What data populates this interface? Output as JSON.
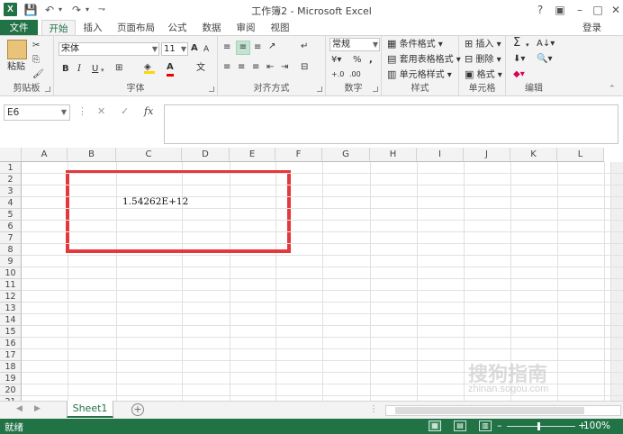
{
  "window": {
    "title": "工作簿2 - Microsoft Excel",
    "login": "登录",
    "help_icon": "?",
    "minimize": "–",
    "restore": "□",
    "close": "✕"
  },
  "tabs": [
    {
      "label": "文件"
    },
    {
      "label": "开始"
    },
    {
      "label": "插入"
    },
    {
      "label": "页面布局"
    },
    {
      "label": "公式"
    },
    {
      "label": "数据"
    },
    {
      "label": "审阅"
    },
    {
      "label": "视图"
    }
  ],
  "ribbon": {
    "clipboard": {
      "label": "剪贴板",
      "paste": "粘贴"
    },
    "font": {
      "label": "字体",
      "font_name": "宋体",
      "font_size": "11",
      "bold": "B",
      "italic": "I",
      "underline": "U",
      "grow": "A",
      "shrink": "A",
      "font_color": "A",
      "phonetic": "文"
    },
    "alignment": {
      "label": "对齐方式"
    },
    "number": {
      "label": "数字",
      "format": "常规",
      "percent": "%",
      "comma": ","
    },
    "styles": {
      "label": "样式",
      "conditional": "条件格式",
      "table": "套用表格格式",
      "cell": "单元格样式"
    },
    "cells": {
      "label": "单元格",
      "insert": "插入",
      "delete": "删除",
      "format": "格式"
    },
    "editing": {
      "label": "编辑",
      "sum": "Σ"
    }
  },
  "formula_bar": {
    "name_box": "E6",
    "cancel": "✕",
    "enter": "✓",
    "fx": "fx",
    "content": ""
  },
  "grid": {
    "columns": [
      "A",
      "B",
      "C",
      "D",
      "E",
      "F",
      "G",
      "H",
      "I",
      "J",
      "K",
      "L"
    ],
    "rows": [
      "1",
      "2",
      "3",
      "4",
      "5",
      "6",
      "7",
      "8",
      "9",
      "10",
      "11",
      "12",
      "13",
      "14",
      "15",
      "16",
      "17",
      "18",
      "19",
      "20",
      "21"
    ],
    "cell_c4": "1.54262E+12",
    "highlight_color": "#e5383b"
  },
  "watermark": {
    "text": "搜狗指南",
    "url": "zhinan.sogou.com"
  },
  "sheets": {
    "active": "Sheet1",
    "add": "+"
  },
  "status": {
    "text": "就绪",
    "zoom": "100%",
    "accent": "#217346"
  }
}
